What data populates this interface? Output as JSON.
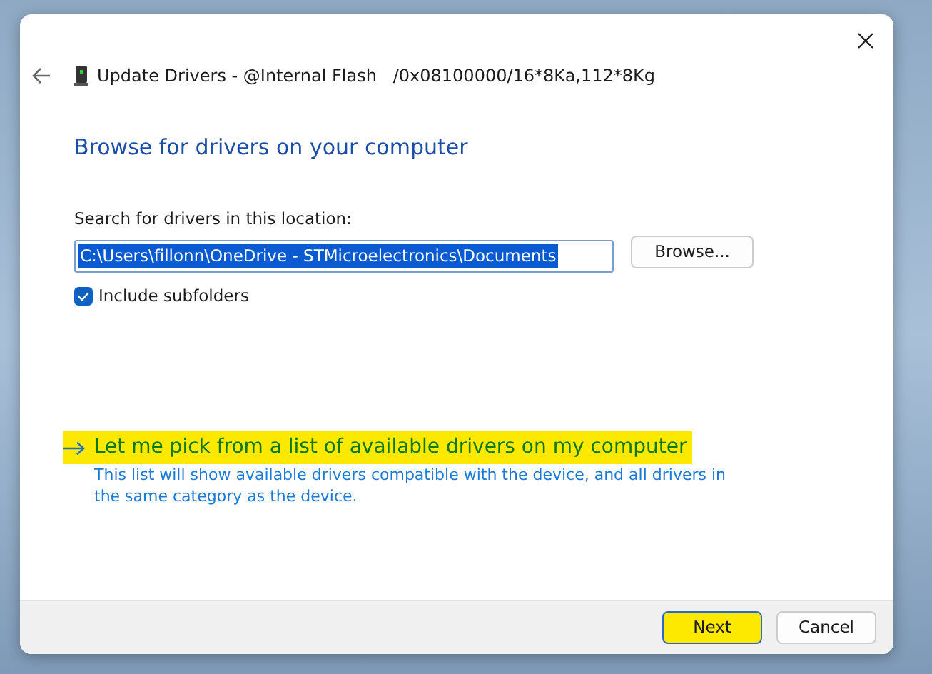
{
  "window": {
    "title": "Update Drivers - @Internal Flash   /0x08100000/16*8Ka,112*8Kg"
  },
  "heading": "Browse for drivers on your computer",
  "location": {
    "label": "Search for drivers in this location:",
    "value": "C:\\Users\\fillonn\\OneDrive - STMicroelectronics\\Documents",
    "browse": "Browse..."
  },
  "include_subfolders": {
    "label": "Include subfolders",
    "checked": true
  },
  "pick_link": {
    "title": "Let me pick from a list of available drivers on my computer",
    "description": "This list will show available drivers compatible with the device, and all drivers in the same category as the device.",
    "highlighted": true
  },
  "buttons": [
    {
      "label": "Next",
      "default": true,
      "highlighted": true
    },
    {
      "label": "Cancel",
      "default": false,
      "highlighted": false
    }
  ]
}
